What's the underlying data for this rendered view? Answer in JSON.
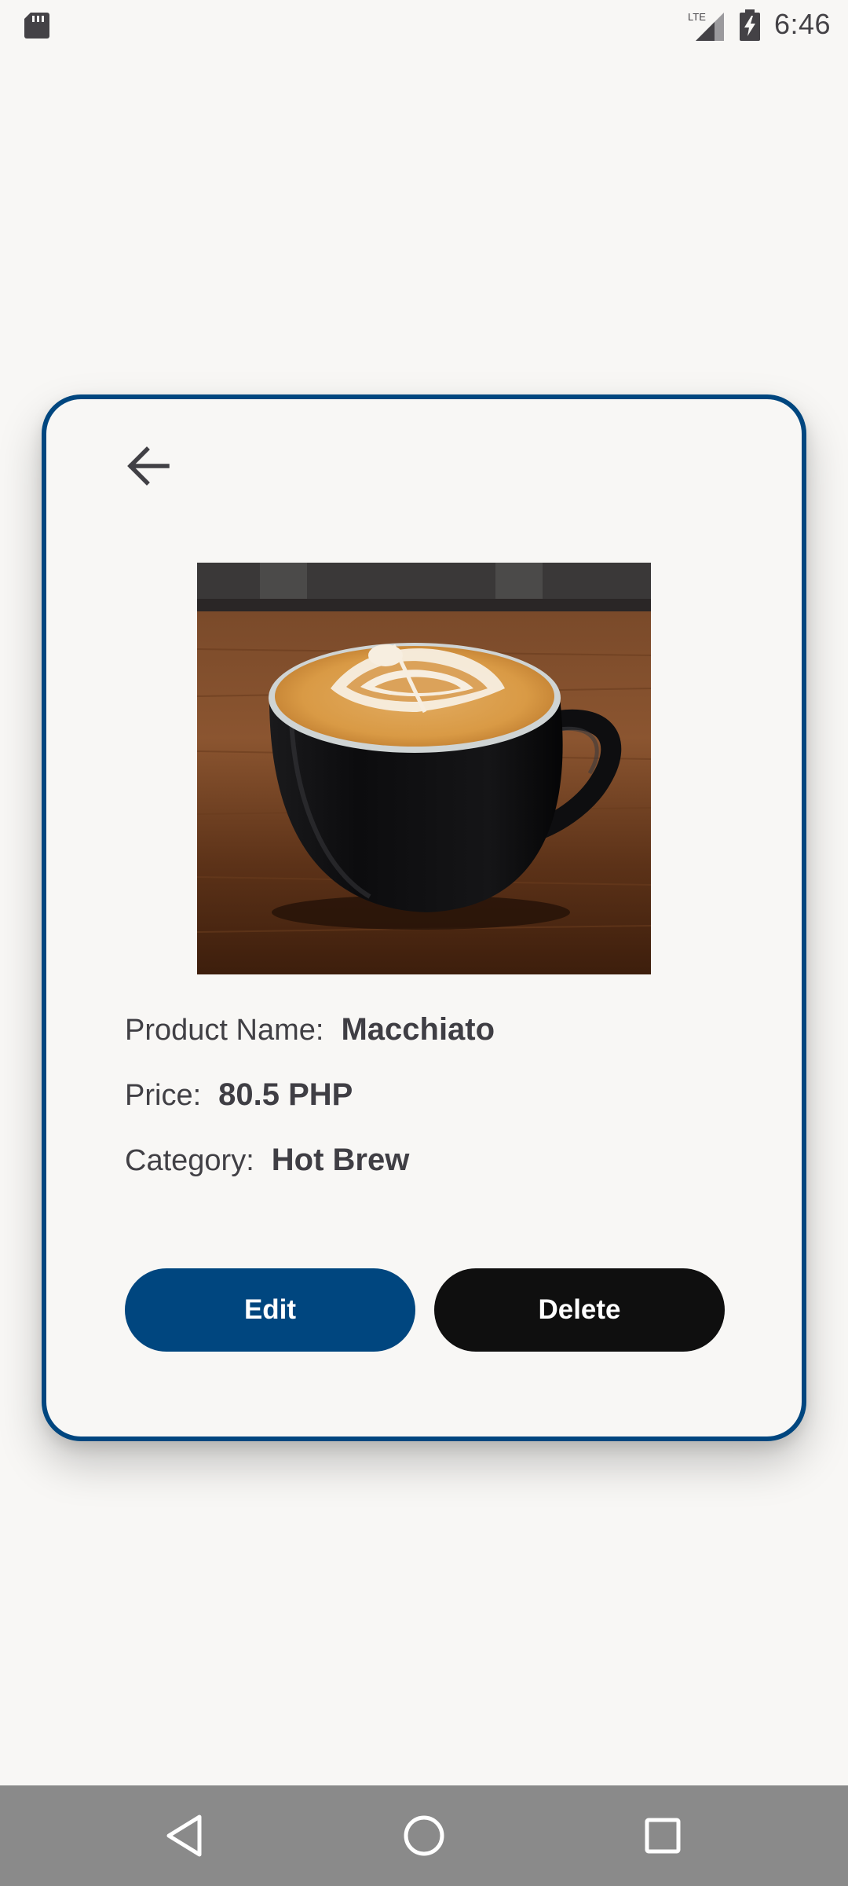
{
  "status_bar": {
    "time": "6:46",
    "network_label": "LTE",
    "icons": [
      "sd-card-icon",
      "lte-signal-icon",
      "battery-charging-icon"
    ]
  },
  "card": {
    "back_icon": "arrow-left-icon",
    "image_alt": "Macchiato coffee cup with latte art",
    "product_name_label": "Product Name:",
    "product_name": "Macchiato",
    "price_label": "Price:",
    "price": "80.5 PHP",
    "category_label": "Category:",
    "category": "Hot Brew",
    "edit_label": "Edit",
    "delete_label": "Delete"
  },
  "nav_bar": {
    "icons": [
      "nav-back-icon",
      "nav-home-icon",
      "nav-recents-icon"
    ]
  },
  "colors": {
    "accent": "#00467f",
    "delete": "#0f0f0f",
    "background": "#f8f7f5",
    "text": "#414045",
    "nav_bar": "#8a8a8a"
  }
}
